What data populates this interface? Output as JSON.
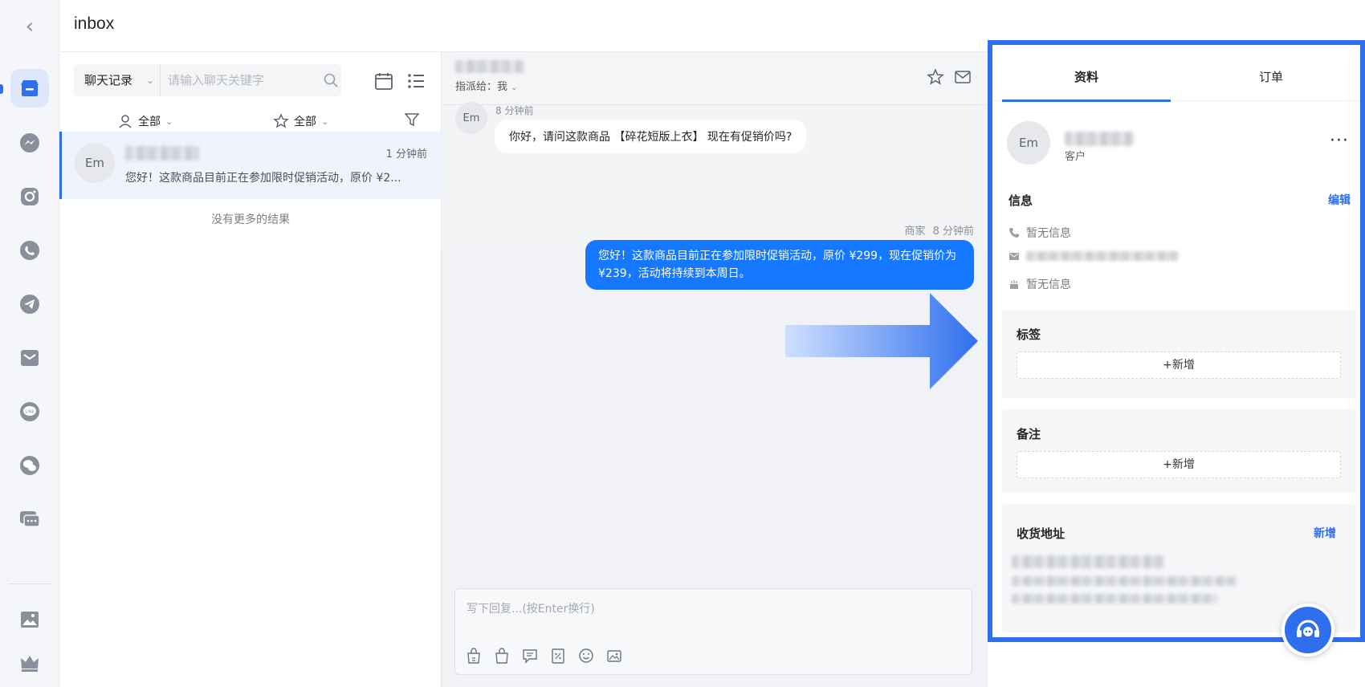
{
  "header": {
    "title": "inbox"
  },
  "rail": {
    "icons": [
      "back-icon",
      "store-icon",
      "messenger-icon",
      "instagram-icon",
      "whatsapp-icon",
      "telegram-icon",
      "email-icon",
      "line-icon",
      "wechat-icon",
      "chat-icon",
      "gallery-icon",
      "crown-icon"
    ]
  },
  "list": {
    "search_scope": "聊天记录",
    "search_placeholder": "请输入聊天关键字",
    "filter_assignee": "全部",
    "filter_star": "全部",
    "conversations": [
      {
        "avatar": "Em",
        "time": "1 分钟前",
        "preview": "您好！这款商品目前正在参加限时促销活动，原价 ¥2..."
      }
    ],
    "no_more": "没有更多的结果"
  },
  "chat": {
    "assign_label": "指派给：我",
    "messages": [
      {
        "from": "customer",
        "avatar": "Em",
        "time": "8 分钟前",
        "text": "你好，请问这款商品 【碎花短版上衣】 现在有促销价吗?"
      },
      {
        "from": "merchant",
        "sender": "商家",
        "time": "8 分钟前",
        "text": "您好！这款商品目前正在参加限时促销活动，原价 ¥299，现在促销价为 ¥239，活动将持续到本周日。"
      }
    ],
    "compose_placeholder": "写下回复...(按Enter换行)"
  },
  "info_panel": {
    "tabs": [
      "资料",
      "订单"
    ],
    "active_tab": "资料",
    "customer": {
      "avatar": "Em",
      "role": "客户"
    },
    "info_title": "信息",
    "edit_label": "编辑",
    "phone": "暂无信息",
    "birthday": "暂无信息",
    "tags_title": "标签",
    "tags_add": "+新增",
    "notes_title": "备注",
    "notes_add": "+新增",
    "address_title": "收货地址",
    "address_add": "新增"
  },
  "colors": {
    "accent": "#2f6fed",
    "bubble_out": "#1677ff",
    "highlight_border": "#2f6fed"
  }
}
